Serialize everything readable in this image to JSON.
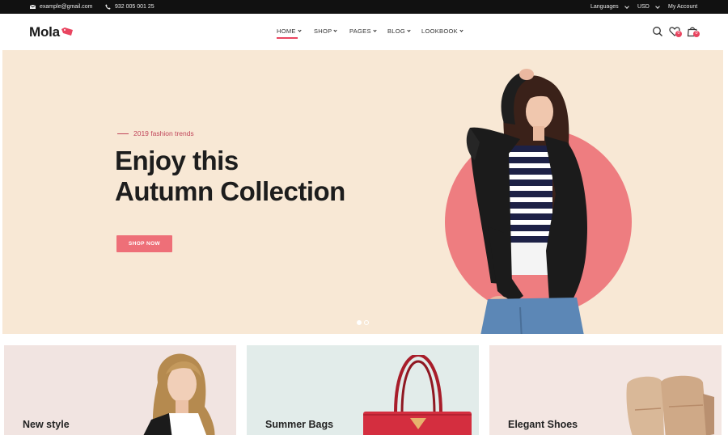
{
  "topbar": {
    "email": "example@gmail.com",
    "phone": "932 005 001 25",
    "languages": "Languages",
    "currency": "USD",
    "account": "My Account"
  },
  "header": {
    "logo": "Mola",
    "nav": [
      {
        "label": "HOME",
        "active": true
      },
      {
        "label": "SHOP",
        "active": false
      },
      {
        "label": "PAGES",
        "active": false
      },
      {
        "label": "BLOG",
        "active": false
      },
      {
        "label": "LOOKBOOK",
        "active": false
      }
    ],
    "wishlist_count": "0",
    "cart_count": "0"
  },
  "hero": {
    "tagline": "2019 fashion trends",
    "title_line1": "Enjoy this",
    "title_line2": "Autumn Collection",
    "button_label": "SHOP NOW",
    "slides_total": 2,
    "active_slide": 1
  },
  "categories": [
    {
      "title": "New style"
    },
    {
      "title": "Summer Bags"
    },
    {
      "title": "Elegant Shoes"
    }
  ],
  "colors": {
    "accent": "#e94560",
    "hero_bg": "#f8e8d5",
    "circle": "#ee7d80",
    "topbar_bg": "#111111"
  },
  "icons": [
    "envelope-icon",
    "phone-icon",
    "search-icon",
    "heart-icon",
    "shopping-bag-icon",
    "logo-tag-icon"
  ]
}
